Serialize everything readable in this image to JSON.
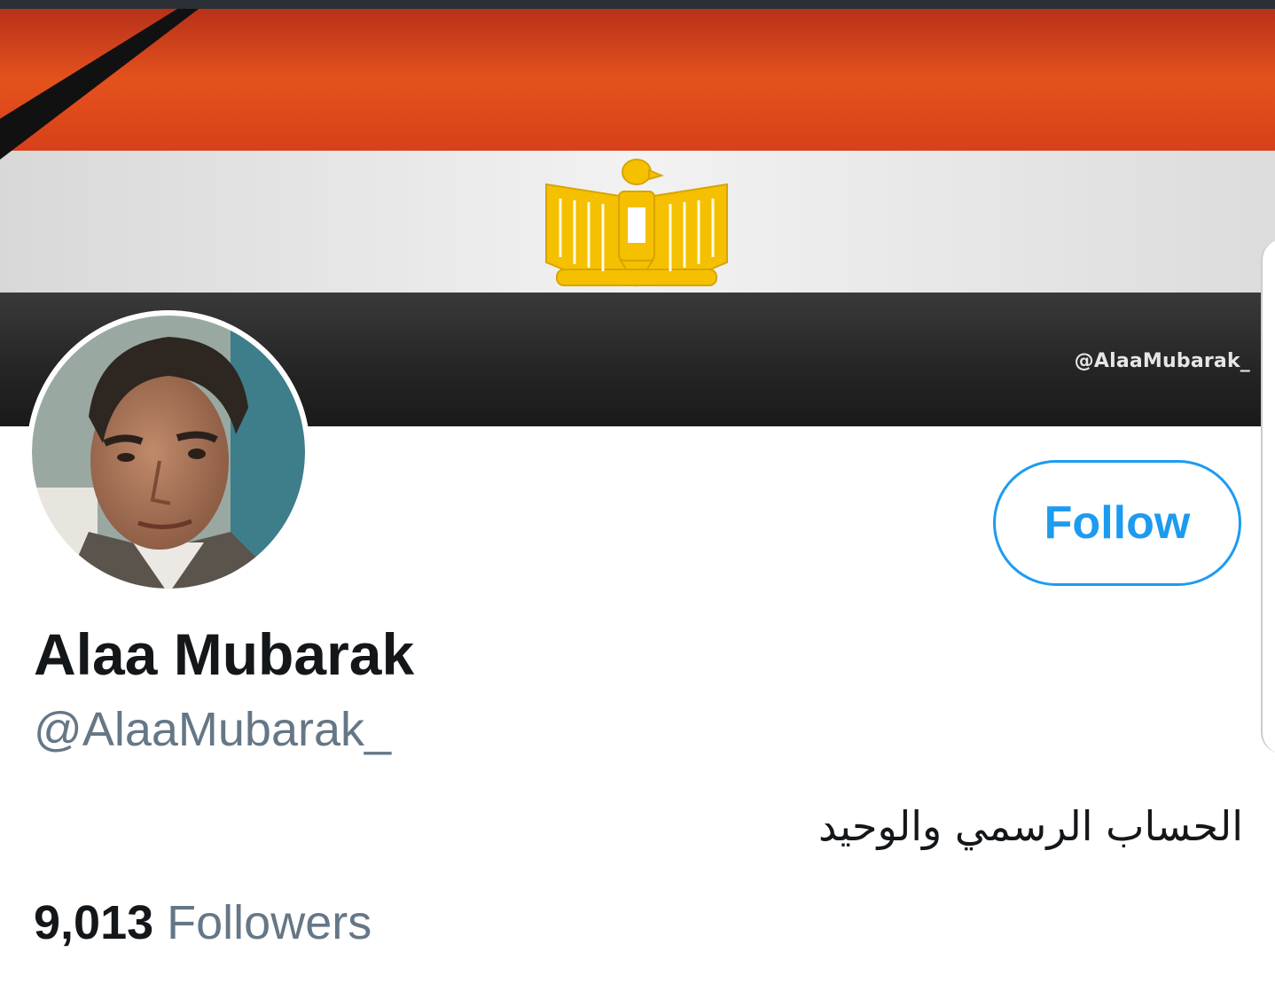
{
  "banner": {
    "watermark_handle": "@AlaaMubarak_",
    "flag_colors": {
      "red": "#d8401a",
      "white": "#e9e9e9",
      "black": "#1e1e1e",
      "eagle_gold": "#f5c000"
    }
  },
  "profile": {
    "display_name": "Alaa Mubarak",
    "handle": "@AlaaMubarak_",
    "bio": "الحساب الرسمي والوحيد",
    "follow_label": "Follow",
    "followers_count": "9,013",
    "followers_label": "Followers"
  },
  "colors": {
    "accent": "#1d9bf0",
    "text_primary": "#14171a",
    "text_secondary": "#657786"
  },
  "icons": {
    "mourning_ribbon": "black-diagonal-ribbon",
    "eagle_emblem": "eagle-of-saladin-icon"
  }
}
